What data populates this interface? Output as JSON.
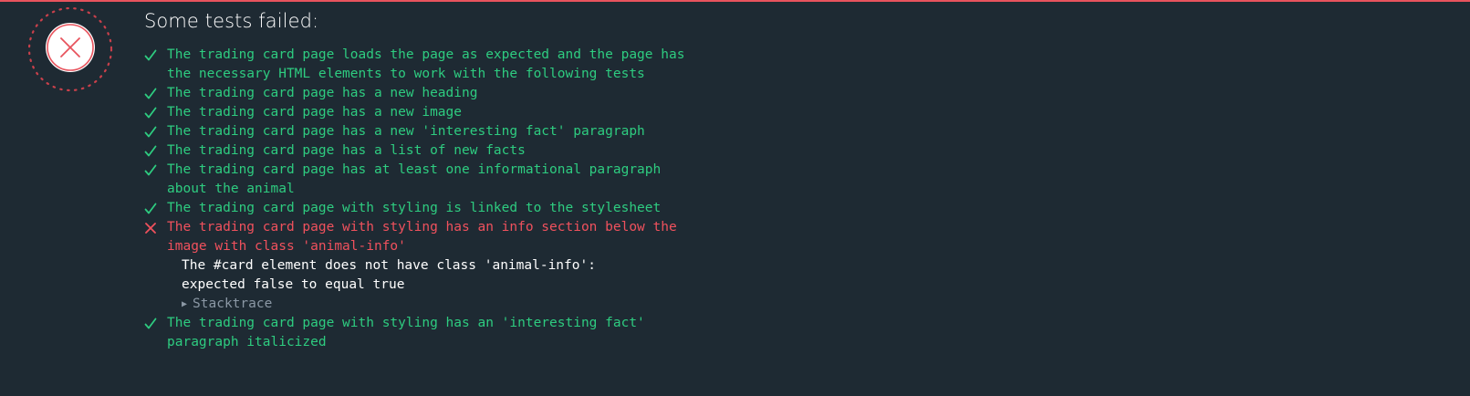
{
  "header": {
    "title": "Some tests failed:"
  },
  "status_icon": "failure-x-circle-icon",
  "colors": {
    "background": "#1e2a33",
    "pass": "#2ecc80",
    "fail": "#f0515d",
    "message": "#ffffff",
    "muted": "#8b98a5"
  },
  "tests": [
    {
      "status": "pass",
      "icon": "checkmark-icon",
      "title": "The trading card page loads the page as expected and the page has the necessary HTML elements to work with the following tests"
    },
    {
      "status": "pass",
      "icon": "checkmark-icon",
      "title": "The trading card page has a new heading"
    },
    {
      "status": "pass",
      "icon": "checkmark-icon",
      "title": "The trading card page has a new image"
    },
    {
      "status": "pass",
      "icon": "checkmark-icon",
      "title": "The trading card page has a new 'interesting fact' paragraph"
    },
    {
      "status": "pass",
      "icon": "checkmark-icon",
      "title": "The trading card page has a list of new facts"
    },
    {
      "status": "pass",
      "icon": "checkmark-icon",
      "title": "The trading card page has at least one informational paragraph about the animal"
    },
    {
      "status": "pass",
      "icon": "checkmark-icon",
      "title": "The trading card page with styling is linked to the stylesheet"
    },
    {
      "status": "fail",
      "icon": "cross-icon",
      "title": "The trading card page with styling has an info section below the image with class 'animal-info'",
      "error": {
        "message": "The #card element does not have class 'animal-info': expected false to equal true",
        "stacktrace_label": "Stacktrace",
        "stacktrace_icon": "triangle-right-icon"
      }
    },
    {
      "status": "pass",
      "icon": "checkmark-icon",
      "title": "The trading card page with styling has an 'interesting fact' paragraph italicized"
    }
  ]
}
